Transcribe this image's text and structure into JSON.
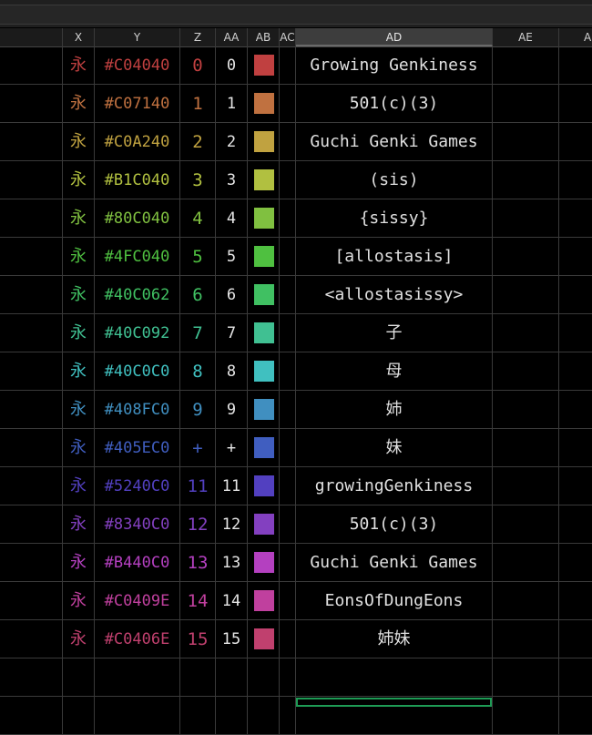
{
  "columns": [
    "X",
    "Y",
    "Z",
    "AA",
    "AB",
    "AC",
    "AD",
    "AE",
    "A"
  ],
  "selected_column": "AD",
  "rows": [
    {
      "x": "永",
      "hex": "#C04040",
      "z": "0",
      "aa": "0",
      "ad": "Growing Genkiness",
      "color": "#C04040"
    },
    {
      "x": "永",
      "hex": "#C07140",
      "z": "1",
      "aa": "1",
      "ad": "501(c)(3)",
      "color": "#C07140"
    },
    {
      "x": "永",
      "hex": "#C0A240",
      "z": "2",
      "aa": "2",
      "ad": "Guchi Genki Games",
      "color": "#C0A240"
    },
    {
      "x": "永",
      "hex": "#B1C040",
      "z": "3",
      "aa": "3",
      "ad": "(sis)",
      "color": "#B1C040"
    },
    {
      "x": "永",
      "hex": "#80C040",
      "z": "4",
      "aa": "4",
      "ad": "{sissy}",
      "color": "#80C040"
    },
    {
      "x": "永",
      "hex": "#4FC040",
      "z": "5",
      "aa": "5",
      "ad": "[allostasis]",
      "color": "#4FC040"
    },
    {
      "x": "永",
      "hex": "#40C062",
      "z": "6",
      "aa": "6",
      "ad": "<allostasissy>",
      "color": "#40C062"
    },
    {
      "x": "永",
      "hex": "#40C092",
      "z": "7",
      "aa": "7",
      "ad": "子",
      "color": "#40C092"
    },
    {
      "x": "永",
      "hex": "#40C0C0",
      "z": "8",
      "aa": "8",
      "ad": "母",
      "color": "#40C0C0"
    },
    {
      "x": "永",
      "hex": "#408FC0",
      "z": "9",
      "aa": "9",
      "ad": "姉",
      "color": "#408FC0"
    },
    {
      "x": "永",
      "hex": "#405EC0",
      "z": "+",
      "aa": "+",
      "ad": "妹",
      "color": "#405EC0"
    },
    {
      "x": "永",
      "hex": "#5240C0",
      "z": "11",
      "aa": "11",
      "ad": "growingGenkiness",
      "color": "#5240C0"
    },
    {
      "x": "永",
      "hex": "#8340C0",
      "z": "12",
      "aa": "12",
      "ad": "501(c)(3)",
      "color": "#8340C0"
    },
    {
      "x": "永",
      "hex": "#B440C0",
      "z": "13",
      "aa": "13",
      "ad": "Guchi Genki Games",
      "color": "#B440C0"
    },
    {
      "x": "永",
      "hex": "#C0409E",
      "z": "14",
      "aa": "14",
      "ad": "EonsOfDungEons",
      "color": "#C0409E"
    },
    {
      "x": "永",
      "hex": "#C0406E",
      "z": "15",
      "aa": "15",
      "ad": "姉妹",
      "color": "#C0406E"
    }
  ]
}
